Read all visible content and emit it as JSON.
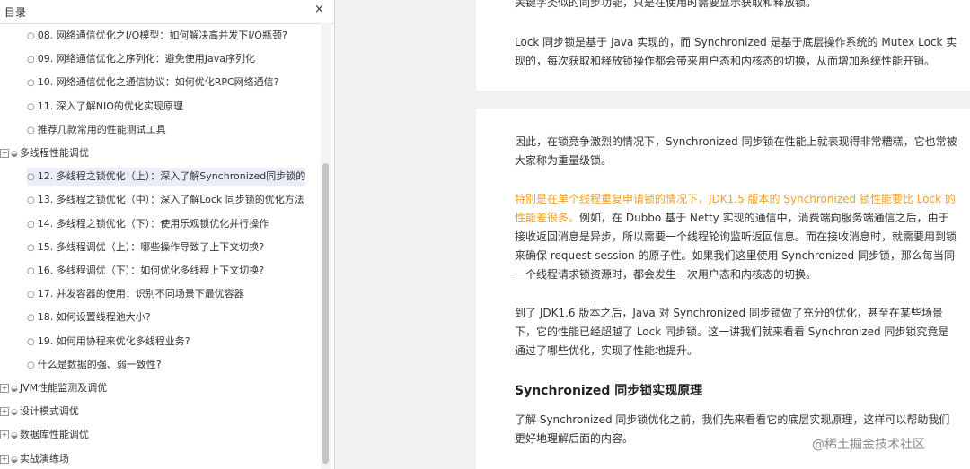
{
  "sidebar": {
    "title": "目录",
    "close_glyph": "×",
    "sub_bullet": "○",
    "expander": "+",
    "collapser": "−",
    "items": [
      {
        "kind": "sub",
        "label": "08. 网络通信优化之I/O模型：如何解决高并发下I/O瓶颈?"
      },
      {
        "kind": "sub",
        "label": "09. 网络通信优化之序列化：避免使用Java序列化"
      },
      {
        "kind": "sub",
        "label": "10. 网络通信优化之通信协议：如何优化RPC网络通信?"
      },
      {
        "kind": "sub",
        "label": "11. 深入了解NIO的优化实现原理"
      },
      {
        "kind": "sub",
        "label": "推荐几款常用的性能测试工具"
      },
      {
        "kind": "section",
        "expanded": true,
        "label": "多线程性能调优"
      },
      {
        "kind": "sub",
        "active": true,
        "label": "12. 多线程之锁优化（上）：深入了解Synchronized同步锁的"
      },
      {
        "kind": "sub",
        "label": "13. 多线程之锁优化（中）：深入了解Lock 同步锁的优化方法"
      },
      {
        "kind": "sub",
        "label": "14. 多线程之锁优化（下）：使用乐观锁优化并行操作"
      },
      {
        "kind": "sub",
        "label": "15. 多线程调优（上）：哪些操作导致了上下文切换?"
      },
      {
        "kind": "sub",
        "label": "16. 多线程调优（下）：如何优化多线程上下文切换?"
      },
      {
        "kind": "sub",
        "label": "17. 并发容器的使用：识别不同场景下最优容器"
      },
      {
        "kind": "sub",
        "label": "18. 如何设置线程池大小?"
      },
      {
        "kind": "sub",
        "label": "19. 如何用协程来优化多线程业务?"
      },
      {
        "kind": "sub",
        "label": "什么是数据的强、弱一致性?"
      },
      {
        "kind": "section",
        "expanded": false,
        "label": "JVM性能监测及调优"
      },
      {
        "kind": "section",
        "expanded": false,
        "label": "设计模式调优"
      },
      {
        "kind": "section",
        "expanded": false,
        "label": "数据库性能调优"
      },
      {
        "kind": "section",
        "expanded": false,
        "label": "实战演练场"
      }
    ]
  },
  "content": {
    "page1_top": "关键字类似的同步功能，只是在使用时需要显示获取和释放锁。",
    "page1_para": "Lock 同步锁是基于 Java 实现的，而 Synchronized 是基于底层操作系统的 Mutex Lock 实现的，每次获取和释放锁操作都会带来用户态和内核态的切换，从而增加系统性能开销。",
    "p_intro": "因此，在锁竞争激烈的情况下，Synchronized 同步锁在性能上就表现得非常糟糕，它也常被大家称为重量级锁。",
    "p_highlight": "特别是在单个线程重复申请锁的情况下，JDK1.5 版本的 Synchronized 锁性能要比 Lock 的性能差很多。",
    "p_rest": "例如，在 Dubbo 基于 Netty 实现的通信中，消费端向服务端通信之后，由于接收返回消息是异步，所以需要一个线程轮询监听返回信息。而在接收消息时，就需要用到锁来确保 request session 的原子性。如果我们这里使用 Synchronized 同步锁，那么每当同一个线程请求锁资源时，都会发生一次用户态和内核态的切换。",
    "p_jdk16": "到了 JDK1.6 版本之后，Java 对 Synchronized 同步锁做了充分的优化，甚至在某些场景下，它的性能已经超越了 Lock 同步锁。这一讲我们就来看看 Synchronized 同步锁究竟是通过了哪些优化，实现了性能地提升。",
    "heading": "Synchronized 同步锁实现原理",
    "p_last": "了解 Synchronized 同步锁优化之前，我们先来看看它的底层实现原理，这样可以帮助我们更好地理解后面的内容。"
  },
  "watermark": "@稀土掘金技术社区",
  "colors": {
    "highlight": "#f3a024",
    "active_item_bg": "#e9eef6"
  }
}
